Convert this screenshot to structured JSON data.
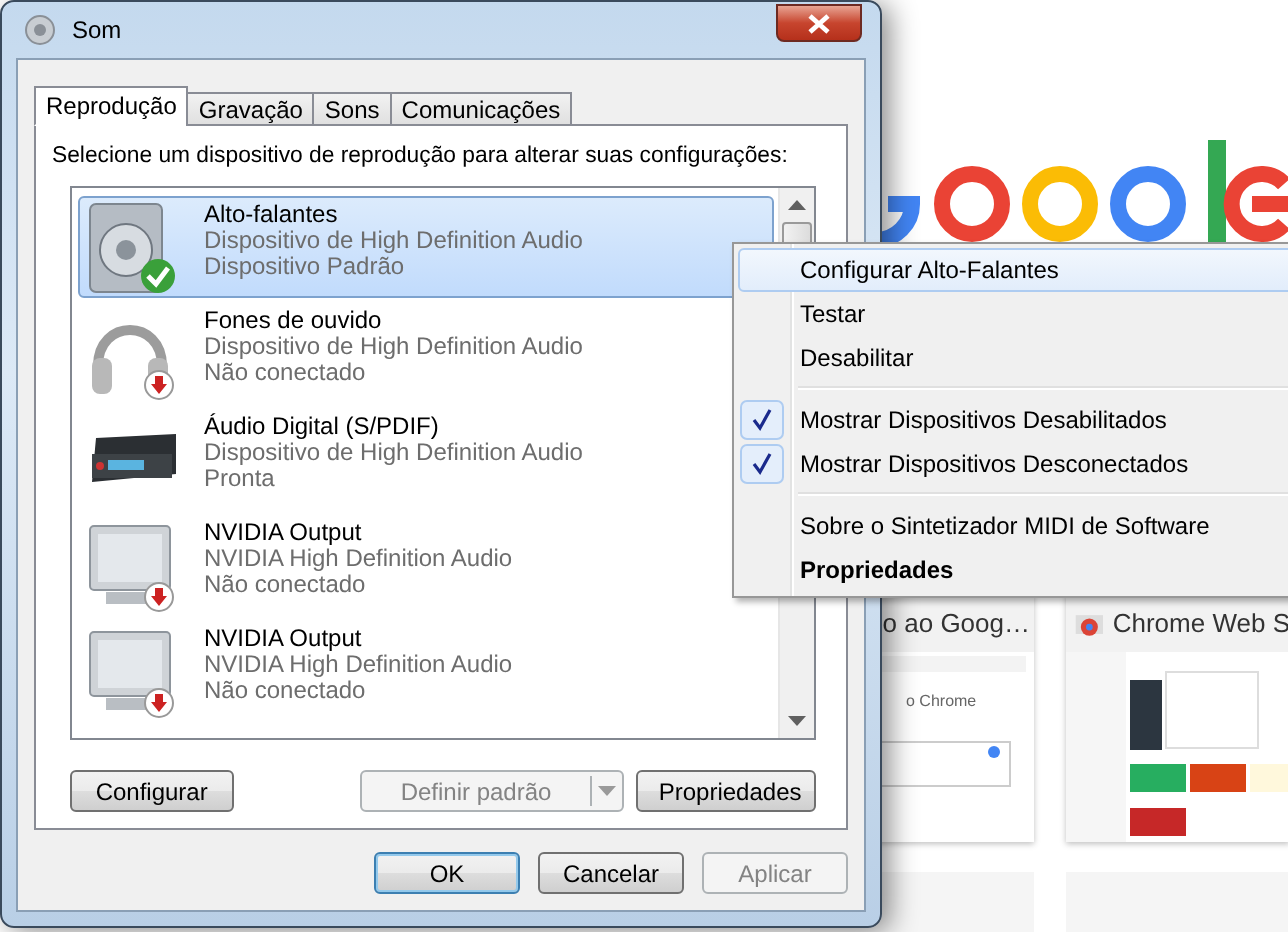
{
  "window": {
    "title": "Som"
  },
  "tabs": [
    {
      "label": "Reprodução",
      "selected": true
    },
    {
      "label": "Gravação",
      "selected": false
    },
    {
      "label": "Sons",
      "selected": false
    },
    {
      "label": "Comunicações",
      "selected": false
    }
  ],
  "instruction": "Selecione um dispositivo de reprodução para alterar suas configurações:",
  "devices": [
    {
      "name": "Alto-falantes",
      "driver": "Dispositivo de High Definition Audio",
      "status": "Dispositivo Padrão",
      "kind": "speaker",
      "is_default": true,
      "disconnected": false,
      "selected": true
    },
    {
      "name": "Fones de ouvido",
      "driver": "Dispositivo de High Definition Audio",
      "status": "Não conectado",
      "kind": "headphones",
      "is_default": false,
      "disconnected": true,
      "selected": false
    },
    {
      "name": "Áudio Digital (S/PDIF)",
      "driver": "Dispositivo de High Definition Audio",
      "status": "Pronta",
      "kind": "receiver",
      "is_default": false,
      "disconnected": false,
      "selected": false
    },
    {
      "name": "NVIDIA Output",
      "driver": "NVIDIA High Definition Audio",
      "status": "Não conectado",
      "kind": "monitor",
      "is_default": false,
      "disconnected": true,
      "selected": false
    },
    {
      "name": "NVIDIA Output",
      "driver": "NVIDIA High Definition Audio",
      "status": "Não conectado",
      "kind": "monitor",
      "is_default": false,
      "disconnected": true,
      "selected": false
    }
  ],
  "panel_buttons": [
    {
      "label": "Configurar",
      "kind": "button",
      "disabled": false
    },
    {
      "label": "Definir padrão",
      "kind": "split",
      "disabled": true
    },
    {
      "label": "Propriedades",
      "kind": "button",
      "disabled": false
    }
  ],
  "dialog_buttons": [
    {
      "label": "OK",
      "disabled": false,
      "focused": true
    },
    {
      "label": "Cancelar",
      "disabled": false,
      "focused": false
    },
    {
      "label": "Aplicar",
      "disabled": true,
      "focused": false
    }
  ],
  "context_menu": [
    {
      "kind": "item",
      "label": "Configurar Alto-Falantes",
      "selected": true,
      "checked": false,
      "bold": false
    },
    {
      "kind": "item",
      "label": "Testar",
      "selected": false,
      "checked": false,
      "bold": false
    },
    {
      "kind": "item",
      "label": "Desabilitar",
      "selected": false,
      "checked": false,
      "bold": false
    },
    {
      "kind": "separator"
    },
    {
      "kind": "item",
      "label": "Mostrar Dispositivos Desabilitados",
      "selected": false,
      "checked": true,
      "bold": false
    },
    {
      "kind": "item",
      "label": "Mostrar Dispositivos Desconectados",
      "selected": false,
      "checked": true,
      "bold": false
    },
    {
      "kind": "separator"
    },
    {
      "kind": "item",
      "label": "Sobre o Sintetizador MIDI de Software",
      "selected": false,
      "checked": false,
      "bold": false
    },
    {
      "kind": "item",
      "label": "Propriedades",
      "selected": false,
      "checked": false,
      "bold": true
    }
  ],
  "background": {
    "tiles": [
      {
        "title": "o ao Goog…",
        "thumbnail_text": "o Chrome"
      },
      {
        "title": "Chrome Web S"
      }
    ]
  }
}
